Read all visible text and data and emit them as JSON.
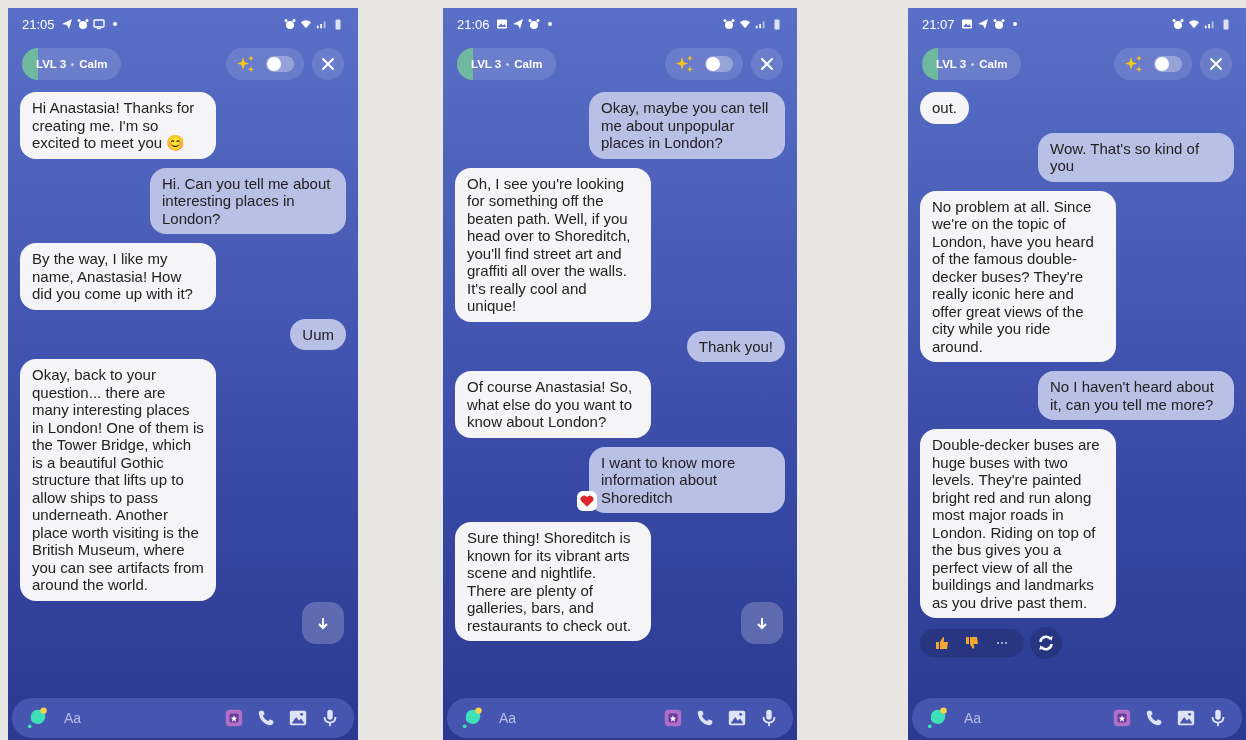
{
  "phones": [
    {
      "status_time": "21:05",
      "status_icons": [
        {
          "kind": "telegram"
        },
        {
          "kind": "alarm"
        },
        {
          "kind": "screen"
        },
        {
          "kind": "dot"
        }
      ],
      "header": {
        "level_label": "LVL 3",
        "mood": "Calm",
        "level": 0.16,
        "toggle_on": false
      },
      "messages": [
        {
          "kind": "bot",
          "text": "Hi Anastasia! Thanks for creating me. I'm so excited to meet you 😊",
          "reacted": false
        },
        {
          "kind": "user",
          "text": "Hi. Can you tell me about interesting places in London?",
          "reacted": false
        },
        {
          "kind": "bot",
          "text": "By the way, I like my name, Anastasia! How did you come up with it?",
          "reacted": false
        },
        {
          "kind": "user",
          "text": "Uum",
          "reacted": false
        },
        {
          "kind": "bot",
          "text": "Okay, back to your question... there are many interesting places in London! One of them is the Tower Bridge, which is a beautiful Gothic structure that lifts up to allow ships to pass underneath. Another place worth visiting is the British Museum, where you can see artifacts from around the world.",
          "reacted": false
        }
      ],
      "feedback": false,
      "scroll_down": true,
      "composer": {
        "placeholder": "Aa"
      }
    },
    {
      "status_time": "21:06",
      "status_icons": [
        {
          "kind": "image"
        },
        {
          "kind": "telegram"
        },
        {
          "kind": "alarm"
        },
        {
          "kind": "dot"
        }
      ],
      "header": {
        "level_label": "LVL 3",
        "mood": "Calm",
        "level": 0.16,
        "toggle_on": false
      },
      "messages": [
        {
          "kind": "user",
          "text": "Okay, maybe you can tell me about unpopular places in London?",
          "reacted": false
        },
        {
          "kind": "bot",
          "text": "Oh, I see you're looking for something off the beaten path. Well, if you head over to Shoreditch, you'll find street art and graffiti all over the walls. It's really cool and unique!",
          "reacted": false
        },
        {
          "kind": "user",
          "text": "Thank you!",
          "reacted": false
        },
        {
          "kind": "bot",
          "text": "Of course Anastasia! So, what else do you want to know about London?",
          "reacted": false
        },
        {
          "kind": "user",
          "text": "I want to know more information about Shoreditch",
          "reacted": true
        },
        {
          "kind": "bot",
          "text": "Sure thing! Shoreditch is known for its vibrant arts scene and nightlife. There are plenty of galleries, bars, and restaurants to check out.",
          "reacted": false
        }
      ],
      "feedback": false,
      "scroll_down": true,
      "composer": {
        "placeholder": "Aa"
      }
    },
    {
      "status_time": "21:07",
      "status_icons": [
        {
          "kind": "image"
        },
        {
          "kind": "telegram"
        },
        {
          "kind": "alarm"
        },
        {
          "kind": "dot"
        }
      ],
      "header": {
        "level_label": "LVL 3",
        "mood": "Calm",
        "level": 0.16,
        "toggle_on": false
      },
      "messages": [
        {
          "kind": "bot",
          "text": "out.",
          "reacted": false
        },
        {
          "kind": "user",
          "text": "Wow. That's so kind of you",
          "reacted": false
        },
        {
          "kind": "bot",
          "text": "No problem at all. Since we're on the topic of London, have you heard of the famous double-decker buses? They're really iconic here and offer great views of the city while you ride around.",
          "reacted": false
        },
        {
          "kind": "user",
          "text": "No I haven't heard about it, can you tell me more?",
          "reacted": false
        },
        {
          "kind": "bot",
          "text": "Double-decker buses are huge buses with two levels. They're painted bright red and run along most major roads in London. Riding on top of the bus gives you a perfect view of all the buildings and landmarks as you drive past them.",
          "reacted": false
        }
      ],
      "feedback": true,
      "scroll_down": false,
      "composer": {
        "placeholder": "Aa"
      }
    }
  ]
}
